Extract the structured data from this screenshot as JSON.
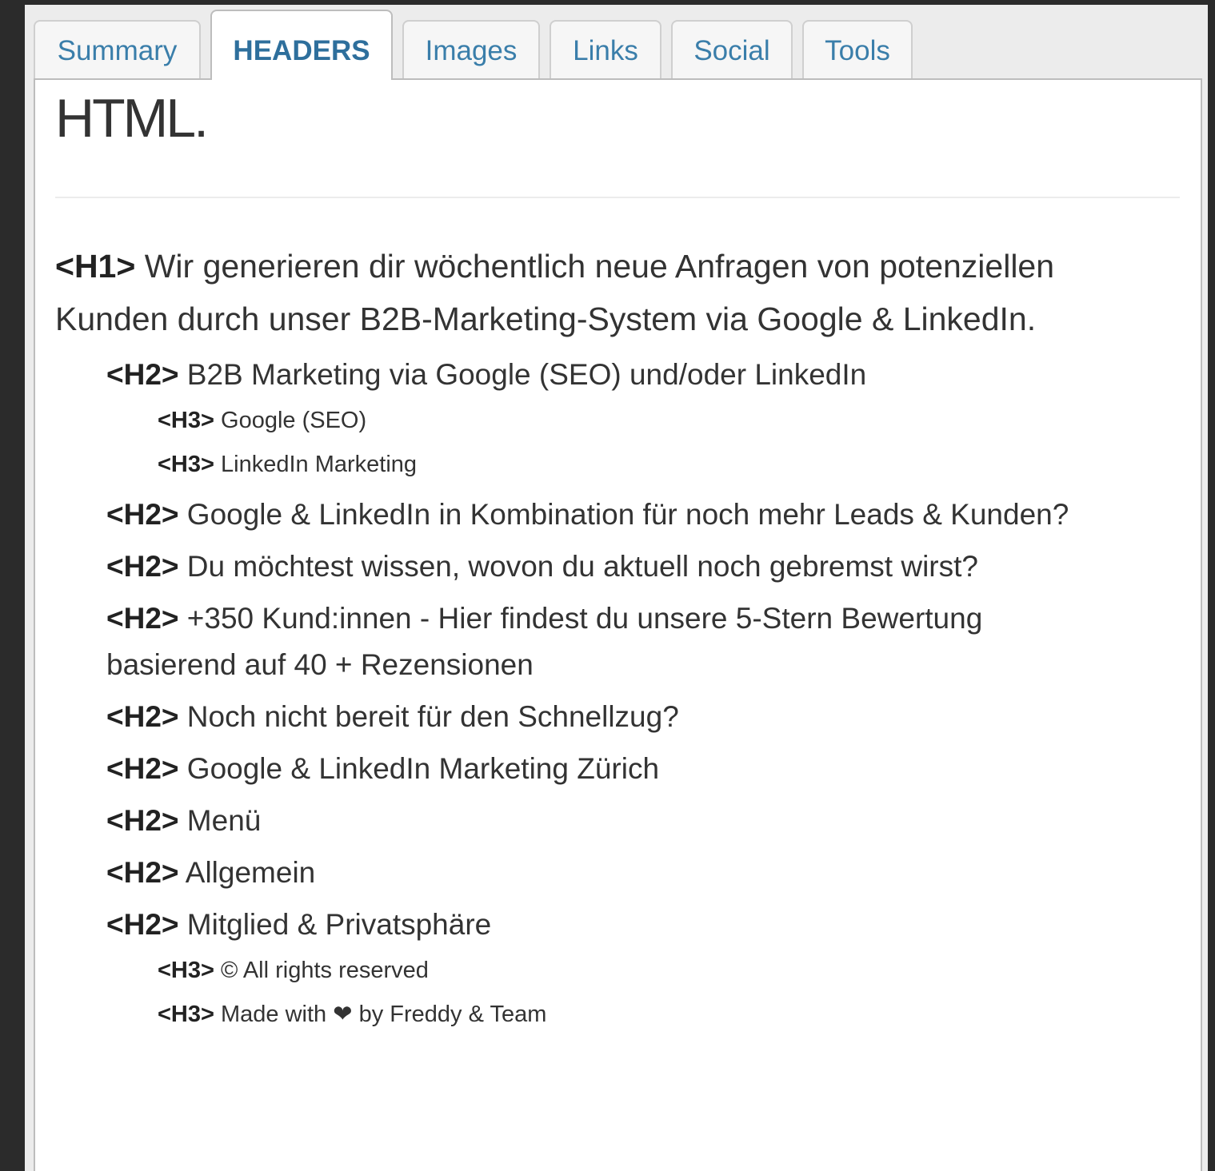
{
  "tabs": [
    {
      "label": "Summary",
      "active": false
    },
    {
      "label": "HEADERS",
      "active": true
    },
    {
      "label": "Images",
      "active": false
    },
    {
      "label": "Links",
      "active": false
    },
    {
      "label": "Social",
      "active": false
    },
    {
      "label": "Tools",
      "active": false
    }
  ],
  "content": {
    "title": "HTML.",
    "headers": [
      {
        "tag": "<H1>",
        "level": 1,
        "text": "Wir generieren dir wöchentlich neue Anfragen von potenziellen Kunden durch unser B2B-Marketing-System via Google & LinkedIn."
      },
      {
        "tag": "<H2>",
        "level": 2,
        "text": "B2B Marketing via Google (SEO) und/oder LinkedIn"
      },
      {
        "tag": "<H3>",
        "level": 3,
        "text": "Google (SEO)"
      },
      {
        "tag": "<H3>",
        "level": 3,
        "text": "LinkedIn Marketing"
      },
      {
        "tag": "<H2>",
        "level": 2,
        "text": "Google & LinkedIn in Kombination für noch mehr Leads & Kunden?"
      },
      {
        "tag": "<H2>",
        "level": 2,
        "text": "Du möchtest wissen, wovon du aktuell noch gebremst wirst?"
      },
      {
        "tag": "<H2>",
        "level": 2,
        "text": "+350 Kund:innen - Hier findest du unsere 5-Stern Bewertung basierend auf 40 + Rezensionen"
      },
      {
        "tag": "<H2>",
        "level": 2,
        "text": "Noch nicht bereit für den Schnellzug?"
      },
      {
        "tag": "<H2>",
        "level": 2,
        "text": "Google & LinkedIn Marketing Zürich"
      },
      {
        "tag": "<H2>",
        "level": 2,
        "text": "Menü"
      },
      {
        "tag": "<H2>",
        "level": 2,
        "text": "Allgemein"
      },
      {
        "tag": "<H2>",
        "level": 2,
        "text": "Mitglied & Privatsphäre"
      },
      {
        "tag": "<H3>",
        "level": 3,
        "text": "© All rights reserved"
      },
      {
        "tag": "<H3>",
        "level": 3,
        "text": "Made with ❤ by Freddy & Team"
      }
    ]
  },
  "colors": {
    "tab_text": "#3a7eaa",
    "background": "#2b2b2b",
    "panel": "#ececec"
  }
}
